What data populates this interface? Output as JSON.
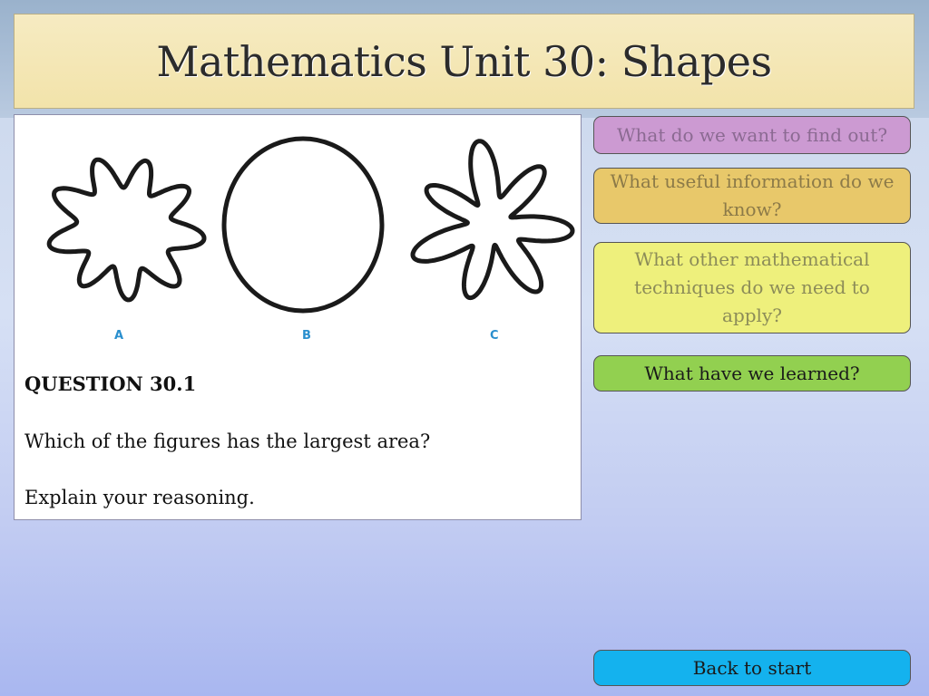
{
  "title": "Mathematics Unit 30: Shapes",
  "figures": {
    "labels": [
      "A",
      "B",
      "C"
    ],
    "colors": {
      "outline": "#1a1a1a",
      "label": "#2a8fce"
    }
  },
  "question": {
    "heading": "QUESTION 30.1",
    "line1": "Which of the figures has the largest area?",
    "line2": "Explain your reasoning."
  },
  "nav": {
    "find_out": "What do we want to find out?",
    "useful_info": "What useful information do we know?",
    "techniques": "What other mathematical techniques do we need to apply?",
    "learned": "What have we learned?",
    "back": "Back to start"
  }
}
